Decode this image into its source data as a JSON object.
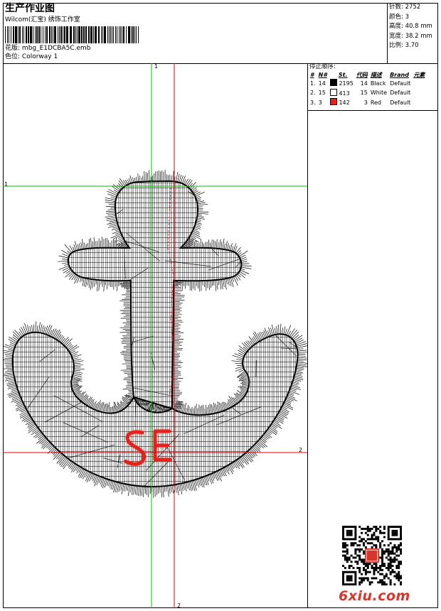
{
  "header": {
    "title": "生产作业图",
    "company": "Wilcom(汇宝) 绣饰工作室",
    "design_label": "花版:",
    "design_name": "mbg_E1DCBA5C.emb",
    "colorway_label": "色位:",
    "colorway_name": "Colorway 1"
  },
  "stats": [
    {
      "label": "针数",
      "value": "2752"
    },
    {
      "label": "颜色",
      "value": "3"
    },
    {
      "label": "高度",
      "value": "40.8 mm"
    },
    {
      "label": "宽度",
      "value": "38.2 mm"
    },
    {
      "label": "比例",
      "value": "3.70"
    }
  ],
  "stop_sequence": {
    "title": "停止顺序:",
    "headers": [
      "#",
      "N#",
      "St.",
      "代码",
      "描述",
      "Brand",
      "元素"
    ],
    "rows": [
      {
        "idx": "1.",
        "needle": "14",
        "color": "#000000",
        "stitches": "2195",
        "code": "14",
        "desc": "Black",
        "brand": "Default"
      },
      {
        "idx": "2.",
        "needle": "15",
        "color": "#ffffff",
        "stitches": "413",
        "code": "15",
        "desc": "White",
        "brand": "Default"
      },
      {
        "idx": "3.",
        "needle": "3",
        "color": "#e8211c",
        "stitches": "142",
        "code": "3",
        "desc": "Red",
        "brand": "Default"
      }
    ]
  },
  "guides": {
    "green_v": "1",
    "green_h": "1",
    "red_h": "2",
    "red_v": "2"
  },
  "colors": {
    "guide_green": "#00c000",
    "guide_red": "#e00000",
    "thread_red": "#e8211c",
    "logo_red": "#d8352d"
  },
  "watermark": {
    "text": "6xiu.com"
  }
}
